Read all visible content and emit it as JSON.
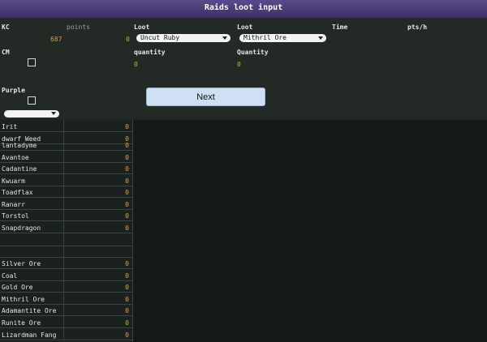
{
  "window": {
    "title": "Raids loot input"
  },
  "header": {
    "kc_label": "KC",
    "points_label": "points",
    "kc_value": "687",
    "points_value": "0",
    "loot1_label": "Loot",
    "loot2_label": "Loot",
    "time_label": "Time",
    "ptsh_label": "pts/h",
    "loot1_selected": "Uncut Ruby",
    "loot2_selected": "Mithril Ore",
    "cm_label": "CM",
    "quantity1_label": "quantity",
    "quantity2_label": "Quantity",
    "quantity1_value": "0",
    "quantity2_value": "0",
    "purple_label": "Purple",
    "purple_selected": "",
    "next_label": "Next"
  },
  "items": [
    {
      "name": "Irit",
      "value": "0"
    },
    {
      "name": "dwarf Weed",
      "value": "0"
    },
    {
      "name": "lantadyme",
      "value": "0"
    },
    {
      "name": "Avantoe",
      "value": "0"
    },
    {
      "name": "Cadantine",
      "value": "0"
    },
    {
      "name": "Kwuarm",
      "value": "0"
    },
    {
      "name": "Toadflax",
      "value": "0"
    },
    {
      "name": "Ranarr",
      "value": "0"
    },
    {
      "name": "Torstol",
      "value": "0"
    },
    {
      "name": "Snapdragon",
      "value": "0"
    },
    {
      "name": "",
      "value": ""
    },
    {
      "name": "",
      "value": ""
    },
    {
      "name": "Silver Ore",
      "value": "0"
    },
    {
      "name": "Coal",
      "value": "0"
    },
    {
      "name": "Gold Ore",
      "value": "0"
    },
    {
      "name": "Mithril Ore",
      "value": "0"
    },
    {
      "name": "Adamantite Ore",
      "value": "0"
    },
    {
      "name": "Runite Ore",
      "value": "0"
    },
    {
      "name": "Lizardman Fang",
      "value": "0"
    }
  ]
}
